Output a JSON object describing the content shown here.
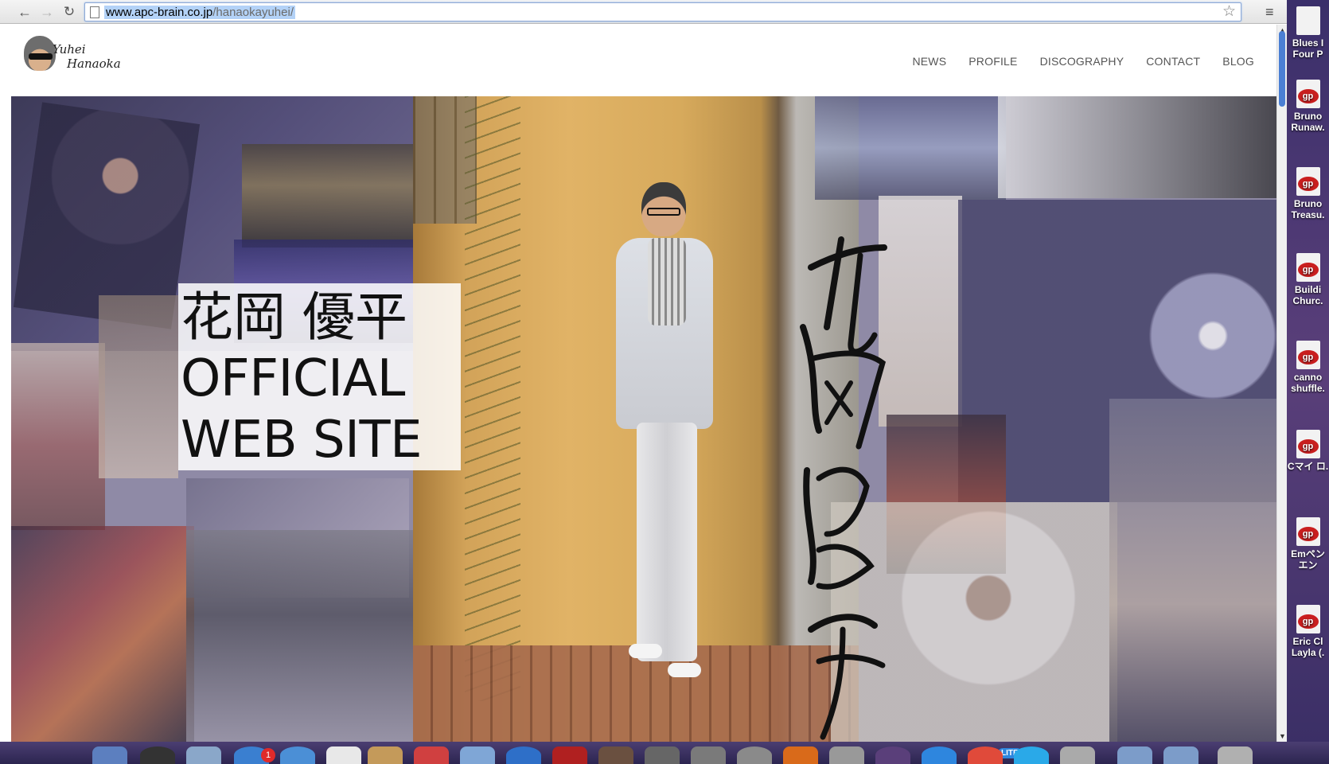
{
  "browser": {
    "url_host": "www.apc-brain.co.jp",
    "url_path": "/hanaokayuhei/",
    "back_glyph": "←",
    "forward_glyph": "→",
    "reload_glyph": "↻",
    "star_glyph": "☆",
    "menu_glyph": "≡"
  },
  "site": {
    "logo_line1": "Yuhei",
    "logo_line2": "Hanaoka",
    "nav": [
      {
        "label": "NEWS"
      },
      {
        "label": "PROFILE"
      },
      {
        "label": "DISCOGRAPHY"
      },
      {
        "label": "CONTACT"
      },
      {
        "label": "BLOG"
      }
    ]
  },
  "hero": {
    "title_jp": "花岡 優平",
    "title_en1": "OFFICIAL",
    "title_en2": "WEB SITE"
  },
  "desktop": {
    "items": [
      {
        "label": "Blues I Four P",
        "badge": ""
      },
      {
        "label": "Bruno Runaw.",
        "badge": "gp"
      },
      {
        "label": "Bruno Treasu.",
        "badge": "gp"
      },
      {
        "label": "Buildi Churc.",
        "badge": "gp"
      },
      {
        "label": "canno shuffle.",
        "badge": "gp"
      },
      {
        "label": "Cマイ ロ.",
        "badge": "gp"
      },
      {
        "label": "Emペン エン",
        "badge": "gp"
      },
      {
        "label": "Eric Cl Layla (.",
        "badge": "gp"
      }
    ]
  },
  "dock": {
    "badge_count": "1",
    "lite_label": "LITE"
  },
  "colors": {
    "accent": "#4b7fd4",
    "nav_text": "#555555",
    "title_text": "#111111"
  }
}
